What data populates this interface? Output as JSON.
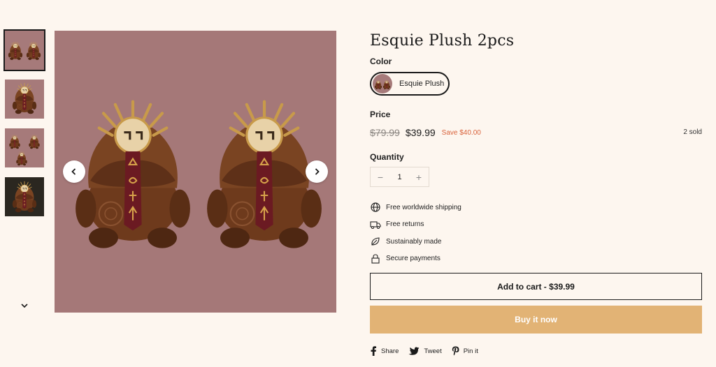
{
  "product": {
    "title": "Esquie Plush 2pcs",
    "image_alt": "Esquie plush pair"
  },
  "gallery": {
    "thumbnails": [
      "thumb-pair",
      "thumb-single",
      "thumb-trio",
      "thumb-dark"
    ],
    "active_index": 0,
    "prev_icon": "chevron-left-icon",
    "next_icon": "chevron-right-icon",
    "down_icon": "chevron-down-icon"
  },
  "color": {
    "label": "Color",
    "selected": "Esquie Plush"
  },
  "price": {
    "label": "Price",
    "compare_at": "$79.99",
    "current": "$39.99",
    "save": "Save $40.00",
    "sold": "2 sold"
  },
  "quantity": {
    "label": "Quantity",
    "value": "1",
    "minus": "−",
    "plus": "+"
  },
  "features": [
    {
      "icon": "globe-icon",
      "text": "Free worldwide shipping"
    },
    {
      "icon": "truck-icon",
      "text": "Free returns"
    },
    {
      "icon": "leaf-icon",
      "text": "Sustainably made"
    },
    {
      "icon": "lock-icon",
      "text": "Secure payments"
    }
  ],
  "actions": {
    "add_to_cart": "Add to cart - $39.99",
    "buy_now": "Buy it now"
  },
  "share": {
    "facebook": "Share",
    "twitter": "Tweet",
    "pinterest": "Pin it"
  },
  "colors": {
    "background": "#fdf6ef",
    "image_bg": "#a57878",
    "accent": "#e2b375",
    "sale": "#d9623b"
  }
}
